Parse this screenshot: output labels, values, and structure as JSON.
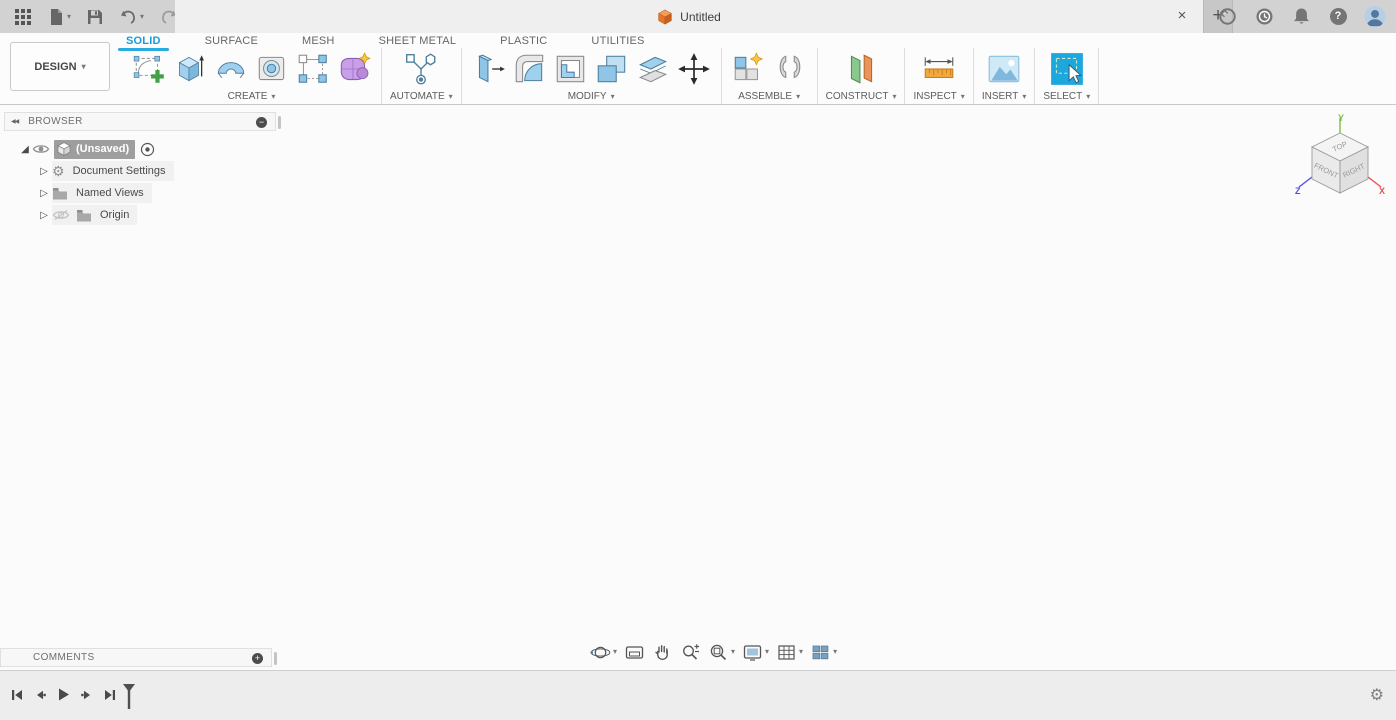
{
  "colors": {
    "accent_blue": "#1a9bd7",
    "underline_blue": "#29abe2",
    "selection_gray": "#9e9e9e",
    "icon_blue": "#8fc6e8",
    "icon_purple": "#c9a0e8",
    "icon_green": "#8bc88b",
    "icon_orange": "#e8945a",
    "titlebar_gray": "#d2d2d2",
    "tab_cube_orange": "#e4762b"
  },
  "icons": {
    "caret_down": "▾",
    "close": "×",
    "new_tab": "+",
    "panel_collapse": "◀◀",
    "tree_expanded": "◢",
    "tree_collapsed": "▷",
    "minus": "−",
    "plus": "+",
    "gear": "⚙",
    "help": "?"
  },
  "titlebar": {
    "tab_title": "Untitled"
  },
  "ribbon": {
    "design_label": "DESIGN",
    "tabs": [
      {
        "label": "SOLID",
        "active": true
      },
      {
        "label": "SURFACE",
        "active": false
      },
      {
        "label": "MESH",
        "active": false
      },
      {
        "label": "SHEET METAL",
        "active": false
      },
      {
        "label": "PLASTIC",
        "active": false
      },
      {
        "label": "UTILITIES",
        "active": false
      }
    ],
    "groups": [
      {
        "label": "CREATE"
      },
      {
        "label": "AUTOMATE"
      },
      {
        "label": "MODIFY"
      },
      {
        "label": "ASSEMBLE"
      },
      {
        "label": "CONSTRUCT"
      },
      {
        "label": "INSPECT"
      },
      {
        "label": "INSERT"
      },
      {
        "label": "SELECT"
      }
    ]
  },
  "browser": {
    "title": "BROWSER",
    "root_label": "(Unsaved)",
    "items": [
      {
        "label": "Document Settings"
      },
      {
        "label": "Named Views"
      },
      {
        "label": "Origin"
      }
    ]
  },
  "viewcube": {
    "top": "TOP",
    "front": "FRONT",
    "right": "RIGHT",
    "axis_x": "X",
    "axis_y": "Y",
    "axis_z": "Z"
  },
  "comments": {
    "title": "COMMENTS"
  }
}
